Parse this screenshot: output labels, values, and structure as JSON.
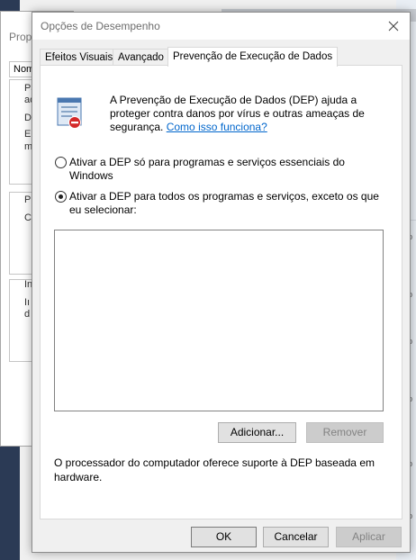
{
  "background": {
    "window_title": "Prop",
    "tab_label": "Nom",
    "fragments": [
      "Pa",
      "ac",
      "D",
      "E",
      "m",
      "P",
      "C",
      "In",
      "Iı",
      "d"
    ],
    "right_row_label": "op"
  },
  "dialog": {
    "title": "Opções de Desempenho",
    "tabs": [
      {
        "label": "Efeitos Visuais"
      },
      {
        "label": "Avançado"
      },
      {
        "label": "Prevenção de Execução de Dados"
      }
    ],
    "description": "A Prevenção de Execução de Dados (DEP) ajuda a proteger contra danos por vírus e outras ameaças de segurança.",
    "link_text": "Como isso funciona?",
    "options": [
      {
        "label": "Ativar a DEP só para programas e serviços essenciais do Windows",
        "checked": false
      },
      {
        "label": "Ativar a DEP para todos os programas e serviços, exceto os que eu selecionar:",
        "checked": true
      }
    ],
    "program_list": [],
    "add_button": "Adicionar...",
    "remove_button": "Remover",
    "remove_enabled": false,
    "hardware_note": "O processador do computador oferece suporte à DEP baseada em hardware.",
    "ok_button": "OK",
    "cancel_button": "Cancelar",
    "apply_button": "Aplicar",
    "apply_enabled": false
  },
  "colors": {
    "link": "#0066cc",
    "desktop": "#2b3a55"
  },
  "icons": {
    "close": "close-icon",
    "dep": "dep-shield-icon"
  }
}
